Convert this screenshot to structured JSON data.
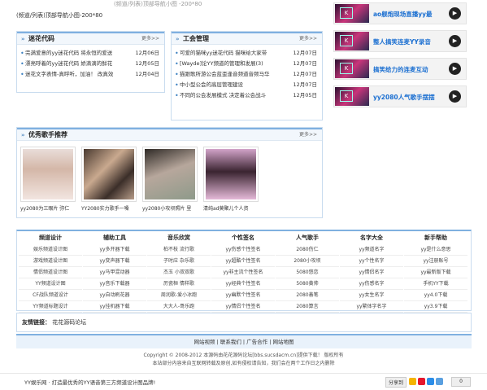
{
  "top_strip": "(频道/列表)顶部导航小图 -200*80",
  "banner_label": "(频道/列表)顶部导航小图-200*80",
  "panels": {
    "left": {
      "title": "迷花代码",
      "more": "更多>>",
      "items": [
        {
          "text": "完满爱意的yy迷花代码 将永恒的爱送",
          "date": "12月06日"
        },
        {
          "text": "漂亮呼着的yy迷花代码 娇滴滴的鲜花",
          "date": "12月05日"
        },
        {
          "text": "迷花文字表情-真呼听，加油！ 改真效",
          "date": "12月04日"
        }
      ]
    },
    "middle": {
      "title": "工会管理",
      "more": "更多>>",
      "items": [
        {
          "text": "可爱的猫咪yy迷花代码 猫咪给大家带",
          "date": "12月07日"
        },
        {
          "text": "[Wayde]论YY频道的管理和发展(3)",
          "date": "12月07日"
        },
        {
          "text": "猫跟歌所游公会蓝歪逢音频道音频马华",
          "date": "12月07日"
        },
        {
          "text": "中小型公会的高层管理建设",
          "date": "12月07日"
        },
        {
          "text": "不同的公会发展模式 决定着公会战斗",
          "date": "12月05日"
        }
      ]
    },
    "singers": {
      "title": "优秀歌手推荐",
      "more": "更多>>",
      "items": [
        {
          "caption": "yy2080为三眼片 弥仁"
        },
        {
          "caption": "YY2080实力歌手一嗓"
        },
        {
          "caption": "yy2080小攻坝照片 里"
        },
        {
          "caption": "清纯ad莫聚儿个人资"
        }
      ]
    }
  },
  "right_list": [
    {
      "title": "ao舰炮现场直播yy最"
    },
    {
      "title": "整人搞笑连麦YY录音"
    },
    {
      "title": "搞笑给力的连麦互动"
    },
    {
      "title": "yy2080人气歌手摆摆"
    }
  ],
  "link_columns": [
    {
      "header": "频道设计",
      "items": [
        "娱乐频道设计图",
        "游戏频道设计图",
        "情侣频道设计图",
        "YY频道设计图",
        "CF战队频道设计",
        "YY频道标题设计"
      ]
    },
    {
      "header": "辅助工具",
      "items": [
        "yy多开器下载",
        "yy变声器下载",
        "yy马甲混动器",
        "yy音乐下载器",
        "yy自动刷花器",
        "yy挂机器下载"
      ]
    },
    {
      "header": "音乐欣赏",
      "items": [
        "柏不枝 流行歌",
        "子时应 杂乐歌",
        "杰玉 小双双歌",
        "厉瓷桓 情样歌",
        "周润歌-爱小冰跑",
        "大大人-哥乐跑"
      ]
    },
    {
      "header": "个性签名",
      "items": [
        "yy伤感个性签名",
        "yy超酷个性签名",
        "yy非主流个性签名",
        "yy经典个性签名",
        "yy幽默个性签名",
        "yy情侣个性签名"
      ]
    },
    {
      "header": "人气歌手",
      "items": [
        "2080伤仁",
        "2080小攻坝",
        "5080悠恋",
        "5080黄帅",
        "2080善笔",
        "2080算言"
      ]
    },
    {
      "header": "名字大全",
      "items": [
        "yy频道名字",
        "yy个性名字",
        "yy情侣名字",
        "yy伤感名字",
        "yy女生名字",
        "yy繁体字名字"
      ]
    },
    {
      "header": "新手帮助",
      "items": [
        "yy是什么意思",
        "yy注册账号",
        "yy最新版下载",
        "手机YY下载",
        "yy4.0下载",
        "yy3.9下载"
      ]
    }
  ],
  "friend_links": {
    "label": "友情链接：",
    "value": "花花源码论坛"
  },
  "footer_nav": [
    "网站视频",
    "联系我们",
    "广告合作",
    "网站地图"
  ],
  "copyright": "Copyright © 2008-2012 本源码由花花源码论坛[bbs.sucsdacm.cn]提供下载！ 版权所有",
  "disclaimer": "本站部分内容来自互联网转载及原创,如有侵权请告知，我们会在两个工作日之内删除",
  "bottom_left": "YY娱乐网 · 打造最优秀的YY语音第三方频道设计图品牌!",
  "share_label": "分享到",
  "share_count": "0",
  "colors": {
    "accent": "#7fb0e0",
    "link": "#1b6fd1"
  }
}
